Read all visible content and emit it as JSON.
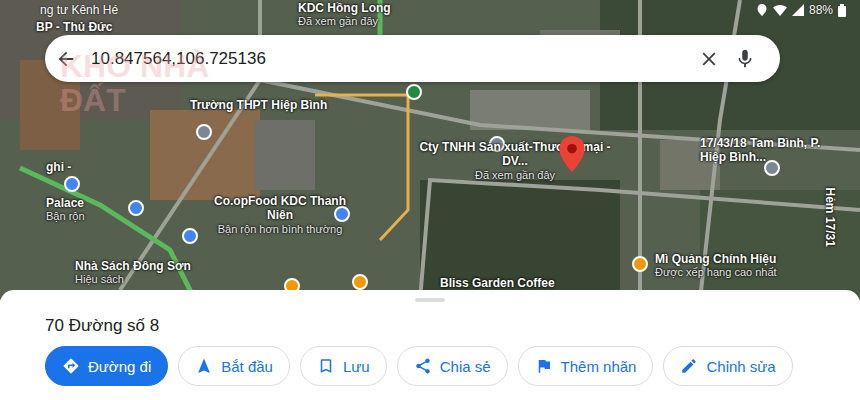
{
  "status_bar": {
    "left": "ng tư Kênh Hé",
    "battery": "88%"
  },
  "search": {
    "value": "10.847564,106.725136"
  },
  "watermark": "KHO NHÀ ĐẤT",
  "map_labels": [
    {
      "name": "KDC Hồng Long",
      "sub": "Đã xem gần đây"
    },
    {
      "name": "Trường THPT Hiệp Bình"
    },
    {
      "name": "Cty TNHH Sản xuất-Thương mại - DV...",
      "sub": "Đã xem gần đây"
    },
    {
      "name": "17/43/18 Tam Bình, P. Hiệp Bình..."
    },
    {
      "name": "Hẻm 17/31"
    },
    {
      "name": "Co.opFood KDC Thanh Niên",
      "sub": "Bận rộn hơn bình thường"
    },
    {
      "name": "Nhà Sách Đông Sơn",
      "sub": "Hiệu sách"
    },
    {
      "name": "Mì Quảng Chính Hiệu",
      "sub": "Được xếp hạng cao nhất"
    },
    {
      "name": "Bliss Garden Coffee"
    },
    {
      "name": "Palace",
      "sub": "Bận rộn"
    },
    {
      "name": "ghi -"
    },
    {
      "name": "BP - Thủ Đức"
    }
  ],
  "place": {
    "title": "70 Đường số 8"
  },
  "actions": [
    {
      "label": "Đường đi",
      "selected": true
    },
    {
      "label": "Bắt đầu",
      "selected": false
    },
    {
      "label": "Lưu",
      "selected": false
    },
    {
      "label": "Chia sẻ",
      "selected": false
    },
    {
      "label": "Thêm nhãn",
      "selected": false
    },
    {
      "label": "Chỉnh sửa",
      "selected": false
    }
  ]
}
